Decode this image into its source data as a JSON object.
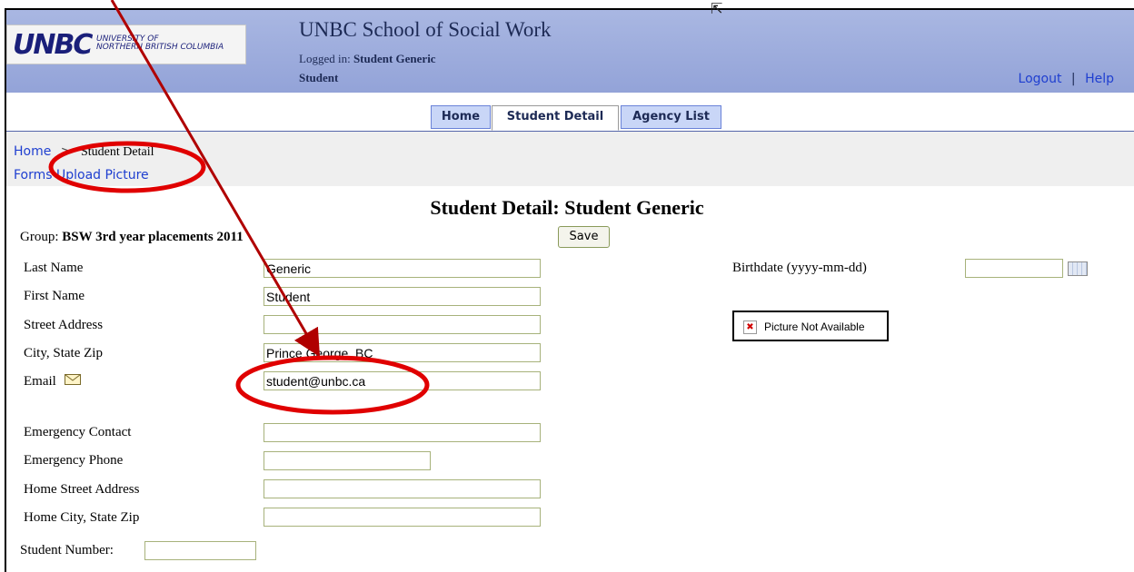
{
  "header": {
    "logo_mark": "UNBC",
    "logo_text_line1": "UNIVERSITY OF",
    "logo_text_line2": "NORTHERN BRITISH COLUMBIA",
    "site_title": "UNBC School of Social Work",
    "logged_in_prefix": "Logged in:",
    "logged_in_user": "Student Generic",
    "role": "Student",
    "logout_label": "Logout",
    "separator": "|",
    "help_label": "Help"
  },
  "tabs": [
    {
      "label": "Home",
      "active": false
    },
    {
      "label": "Student Detail",
      "active": true
    },
    {
      "label": "Agency List",
      "active": false
    }
  ],
  "breadcrumb": {
    "home": "Home",
    "separator": ">",
    "current": "Student Detail"
  },
  "subnav": {
    "forms": "Forms",
    "upload_picture": "Upload Picture"
  },
  "page": {
    "title": "Student Detail: Student Generic",
    "group_prefix": "Group:",
    "group_value": "BSW 3rd year placements 2011",
    "save_label": "Save"
  },
  "fields": {
    "last_name": {
      "label": "Last Name",
      "value": "Generic"
    },
    "first_name": {
      "label": "First Name",
      "value": "Student"
    },
    "street_address": {
      "label": "Street Address",
      "value": ""
    },
    "city_state_zip": {
      "label": "City, State Zip",
      "value": "Prince George, BC"
    },
    "email": {
      "label": "Email",
      "value": "student@unbc.ca"
    },
    "emergency_contact": {
      "label": "Emergency Contact",
      "value": ""
    },
    "emergency_phone": {
      "label": "Emergency Phone",
      "value": ""
    },
    "home_street_address": {
      "label": "Home Street Address",
      "value": ""
    },
    "home_city_state_zip": {
      "label": "Home City, State Zip",
      "value": ""
    },
    "student_number": {
      "label": "Student Number:",
      "value": ""
    },
    "birthdate": {
      "label": "Birthdate (yyyy-mm-dd)",
      "value": ""
    }
  },
  "picture": {
    "text": "Picture Not Available",
    "icon": "broken-image-icon"
  },
  "icons": {
    "email": "envelope-icon",
    "calendar": "calendar-icon",
    "cursor": "mouse-pointer-icon"
  },
  "colors": {
    "header_bg": "#a9b7e2",
    "link": "#1f3fd0",
    "annotation": "#cc0000",
    "input_border": "#a7b27b"
  }
}
